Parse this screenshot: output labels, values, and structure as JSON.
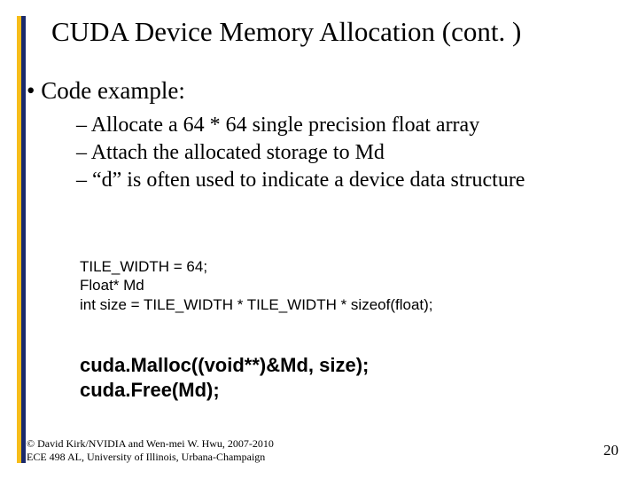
{
  "title": "CUDA Device Memory Allocation (cont. )",
  "bullet_main": "Code example:",
  "sub_bullets": {
    "b0": "Allocate a  64 * 64 single precision float array",
    "b1": "Attach the allocated storage to Md",
    "b2": "“d” is often used to indicate a device data structure"
  },
  "code_small": {
    "l0": "TILE_WIDTH = 64;",
    "l1": "Float* Md",
    "l2": "int size = TILE_WIDTH * TILE_WIDTH * sizeof(float);"
  },
  "code_bold": {
    "l0": "cuda.Malloc((void**)&Md, size);",
    "l1": "cuda.Free(Md);"
  },
  "footer": {
    "l0": "© David Kirk/NVIDIA and Wen-mei W. Hwu, 2007-2010",
    "l1": "ECE 498 AL, University of Illinois, Urbana-Champaign"
  },
  "page_number": "20"
}
